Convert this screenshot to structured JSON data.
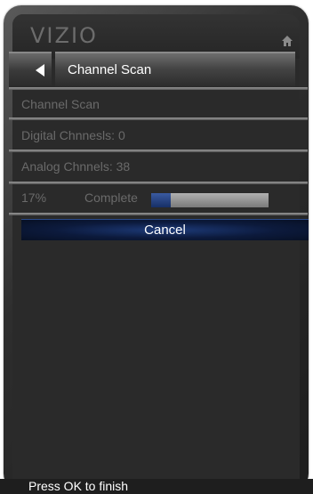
{
  "brand": {
    "logo": "VIZIO"
  },
  "header": {
    "home_icon": "home-icon"
  },
  "menu": {
    "title": "Channel Scan",
    "back_icon": "back-arrow-icon"
  },
  "scan": {
    "row_title": "Channel Scan",
    "digital_channels": "Digital Chnnesls: 0",
    "analog_channels": "Analog Chnnels: 38",
    "percent": "17%",
    "status": "Complete",
    "progress": 0.17
  },
  "actions": {
    "cancel_label": "Cancel"
  },
  "footer": {
    "hint": "Press OK to finish"
  },
  "colors": {
    "accent": "#1d3a78",
    "progress_fill": "#2a4a8c",
    "dim_text": "#6a6a6a"
  }
}
